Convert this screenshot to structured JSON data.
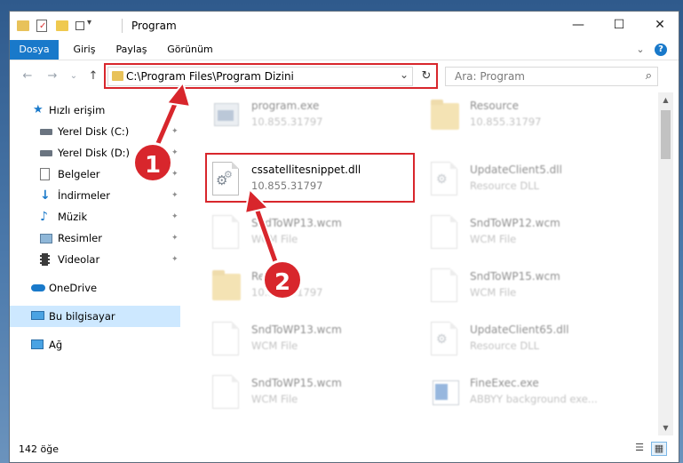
{
  "window": {
    "title": "Program",
    "controls": {
      "minimize": "—",
      "maximize": "☐",
      "close": "✕"
    }
  },
  "ribbon": {
    "tabs": [
      "Dosya",
      "Giriş",
      "Paylaş",
      "Görünüm"
    ],
    "expand_icon": "⌄",
    "help_icon": "?"
  },
  "address": {
    "path": "C:\\Program Files\\Program Dizini",
    "refresh_icon": "↻",
    "dropdown_icon": "⌄",
    "search_placeholder": "Ara: Program",
    "search_icon": "⌕"
  },
  "nav_buttons": {
    "back": "←",
    "forward": "→",
    "recent": "⌄",
    "up": "↑"
  },
  "sidebar": {
    "items": [
      {
        "label": "Hızlı erişim",
        "icon": "star-icon",
        "pinned": false
      },
      {
        "label": "Yerel Disk (C:)",
        "icon": "drive-icon",
        "pinned": true
      },
      {
        "label": "Yerel Disk (D:)",
        "icon": "drive-icon",
        "pinned": true
      },
      {
        "label": "Belgeler",
        "icon": "documents-icon",
        "pinned": true
      },
      {
        "label": "İndirmeler",
        "icon": "downloads-icon",
        "pinned": true
      },
      {
        "label": "Müzik",
        "icon": "music-icon",
        "pinned": true
      },
      {
        "label": "Resimler",
        "icon": "pictures-icon",
        "pinned": true
      },
      {
        "label": "Videolar",
        "icon": "videos-icon",
        "pinned": true
      },
      {
        "label": "OneDrive",
        "icon": "cloud-icon",
        "pinned": false
      },
      {
        "label": "Bu bilgisayar",
        "icon": "computer-icon",
        "pinned": false,
        "selected": true
      },
      {
        "label": "Ağ",
        "icon": "network-icon",
        "pinned": false
      }
    ],
    "pin_icon": "📌"
  },
  "files": [
    {
      "name": "program.exe",
      "sub": "10.855.31797",
      "kind": "exe"
    },
    {
      "name": "Resource",
      "sub": "10.855.31797",
      "kind": "folder"
    },
    {
      "name": "cssatellitesnippet.dll",
      "sub": "10.855.31797",
      "kind": "dll",
      "highlight": true
    },
    {
      "name": "UpdateClient5.dll",
      "sub": "Resource DLL",
      "kind": "dll"
    },
    {
      "name": "SndToWP13.wcm",
      "sub": "WCM File",
      "kind": "doc"
    },
    {
      "name": "SndToWP12.wcm",
      "sub": "WCM File",
      "kind": "doc"
    },
    {
      "name": "Resource",
      "sub": "10.855.31797",
      "kind": "folder"
    },
    {
      "name": "SndToWP15.wcm",
      "sub": "WCM File",
      "kind": "doc"
    },
    {
      "name": "SndToWP13.wcm",
      "sub": "WCM File",
      "kind": "doc"
    },
    {
      "name": "UpdateClient65.dll",
      "sub": "Resource DLL",
      "kind": "dll"
    },
    {
      "name": "SndToWP15.wcm",
      "sub": "WCM File",
      "kind": "doc"
    },
    {
      "name": "FineExec.exe",
      "sub": "ABBYY background exe...",
      "kind": "exe"
    }
  ],
  "status": {
    "count_text": "142 öğe"
  },
  "annotations": {
    "badge1": "1",
    "badge2": "2"
  },
  "colors": {
    "accent": "#1979ca",
    "highlight_red": "#d8262c",
    "selected_bg": "#cde8ff"
  }
}
